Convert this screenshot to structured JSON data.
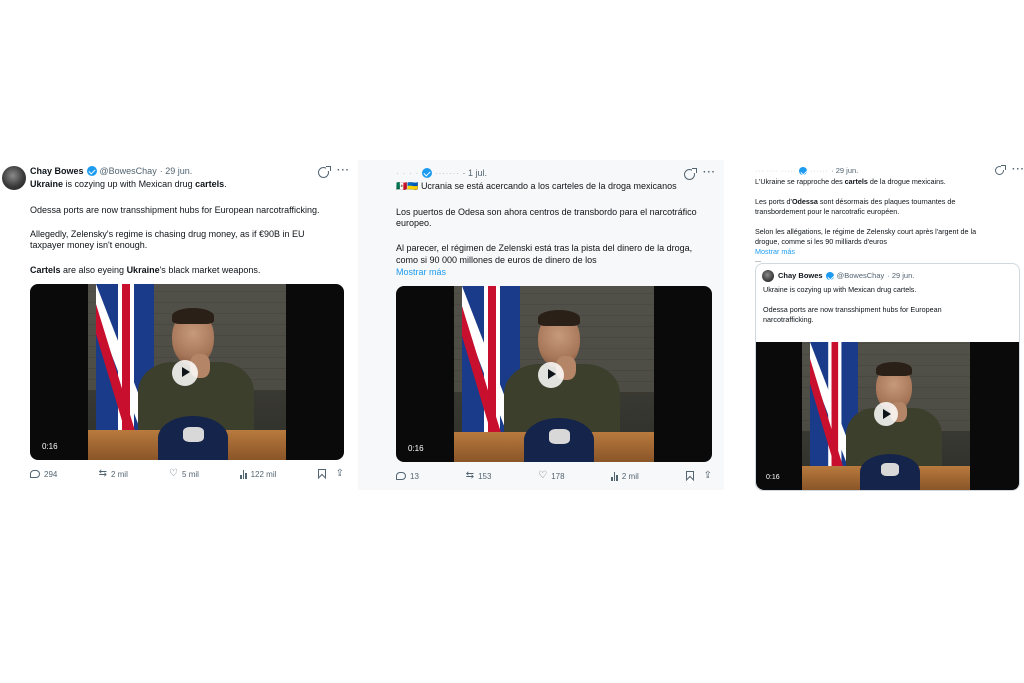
{
  "tweet1": {
    "name": "Chay Bowes",
    "handle": "@BowesChay",
    "date": "· 29 jun.",
    "lines": [
      [
        "",
        "Ukraine",
        " is cozying up with Mexican drug ",
        "cartels",
        "."
      ],
      "Odessa ports are now transshipment hubs for European narcotrafficking.",
      "Allegedly, Zelensky's regime is chasing drug money, as if €90B in EU",
      "taxpayer money isn't enough.",
      [
        "",
        "Cartels",
        " are also eyeing ",
        "Ukraine",
        "'s black market weapons."
      ]
    ],
    "video_time": "0:16",
    "replies": "294",
    "retweets": "2 mil",
    "likes": "5 mil",
    "views": "122 mil"
  },
  "tweet2": {
    "name_blurred": "· · · ·",
    "handle_blurred": "·······",
    "date": "· 1 jul.",
    "flags": "🇲🇽🇺🇦",
    "lines": [
      "Ucrania se está acercando a los carteles de la droga mexicanos",
      "Los puertos de Odesa son ahora centros de transbordo para el narcotráfico",
      "europeo.",
      "Al parecer, el régimen de Zelenski está tras la pista del dinero de la droga,",
      "como si 90 000 millones de euros de dinero de los"
    ],
    "show_more": "Mostrar más",
    "video_time": "0:16",
    "replies": "13",
    "retweets": "153",
    "likes": "178",
    "views": "2 mil"
  },
  "tweet3": {
    "handle_blurred": "··· ···· ·····",
    "date": "· 29 jun.",
    "lines": [
      [
        "L'Ukraine se rapproche des ",
        "cartels",
        " de la drogue mexicains."
      ],
      [
        "Les ports d'",
        "Odessa",
        " sont désormais des plaques tournantes de"
      ],
      "transbordement pour le narcotrafic européen.",
      "Selon les allégations, le régime de Zelensky court après l'argent de la",
      "drogue, comme si les 90 milliards d'euros"
    ],
    "show_more": "Mostrar más",
    "ellipsis": "...",
    "quote": {
      "name": "Chay Bowes",
      "handle": "@BowesChay",
      "date": "· 29 jun.",
      "lines": [
        "Ukraine is cozying up with Mexican drug cartels.",
        "Odessa ports are now transshipment hubs for European",
        "narcotrafficking."
      ],
      "video_time": "0:16"
    }
  },
  "icons": {
    "grok": "grok-icon",
    "more": "more-dots-icon",
    "reply": "reply-icon",
    "retweet": "retweet-icon",
    "like": "heart-icon",
    "views": "views-icon",
    "bookmark": "bookmark-icon",
    "share": "share-icon",
    "play": "play-icon",
    "verified": "verified-badge-icon"
  },
  "colors": {
    "accent": "#1d9bf0",
    "text": "#0f1419",
    "muted": "#536471"
  }
}
